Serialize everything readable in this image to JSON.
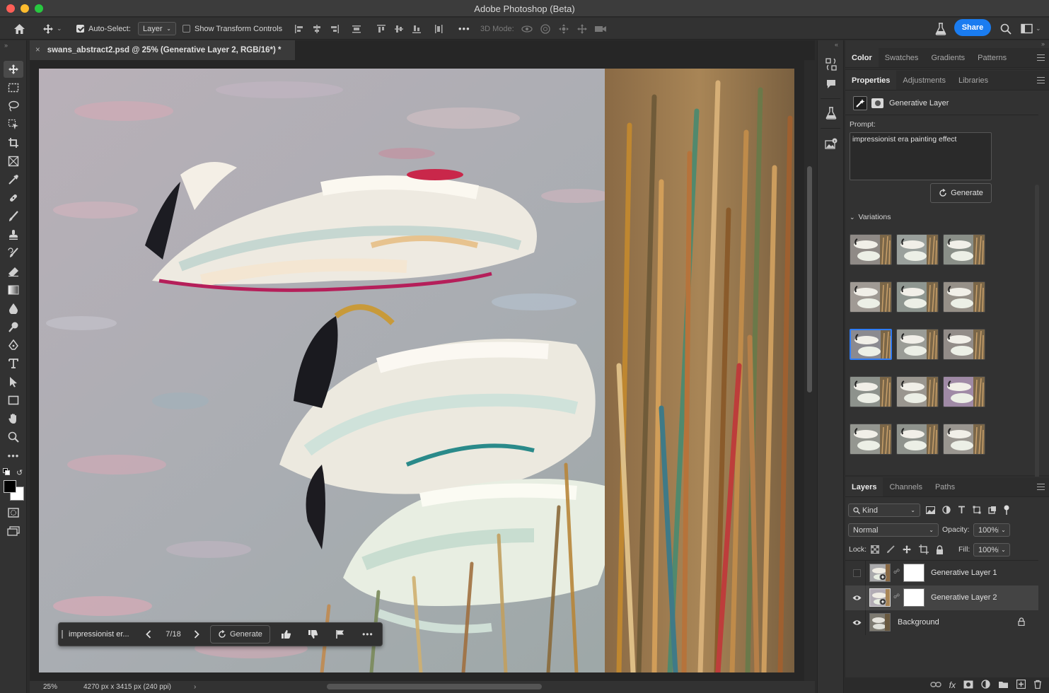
{
  "window": {
    "title": "Adobe Photoshop (Beta)"
  },
  "options_bar": {
    "auto_select_label": "Auto-Select:",
    "auto_select_checked": true,
    "auto_select_value": "Layer",
    "transform_controls_label": "Show Transform Controls",
    "transform_controls_checked": false,
    "more_label": "•••",
    "mode_3d_label": "3D Mode:",
    "share_label": "Share"
  },
  "document": {
    "tab_title": "swans_abstract2.psd @ 25% (Generative Layer 2, RGB/16*) *"
  },
  "context_bar": {
    "prompt": "impressionist er...",
    "counter": "7/18",
    "generate_label": "Generate",
    "more_label": "•••"
  },
  "status_bar": {
    "zoom": "25%",
    "dimensions": "4270 px x 3415 px (240 ppi)"
  },
  "top_panel": {
    "tabs": [
      "Color",
      "Swatches",
      "Gradients",
      "Patterns"
    ],
    "active": "Color"
  },
  "properties_panel": {
    "tabs": [
      "Properties",
      "Adjustments",
      "Libraries"
    ],
    "active": "Properties",
    "layer_type": "Generative Layer",
    "prompt_label": "Prompt:",
    "prompt_value": "impressionist era painting effect",
    "generate_label": "Generate",
    "variations_label": "Variations",
    "selected_variation": 7
  },
  "layers_panel": {
    "tabs": [
      "Layers",
      "Channels",
      "Paths"
    ],
    "active": "Layers",
    "filter_kind": "Kind",
    "blend_mode": "Normal",
    "opacity_label": "Opacity:",
    "opacity": "100%",
    "lock_label": "Lock:",
    "fill_label": "Fill:",
    "fill": "100%",
    "layers": [
      {
        "name": "Generative Layer 1",
        "visible": false,
        "selected": false
      },
      {
        "name": "Generative Layer 2",
        "visible": true,
        "selected": true
      },
      {
        "name": "Background",
        "visible": true,
        "selected": false,
        "locked": true
      }
    ]
  },
  "colors": {
    "accent": "#1a7cf0",
    "selection": "#2f7cf6"
  }
}
